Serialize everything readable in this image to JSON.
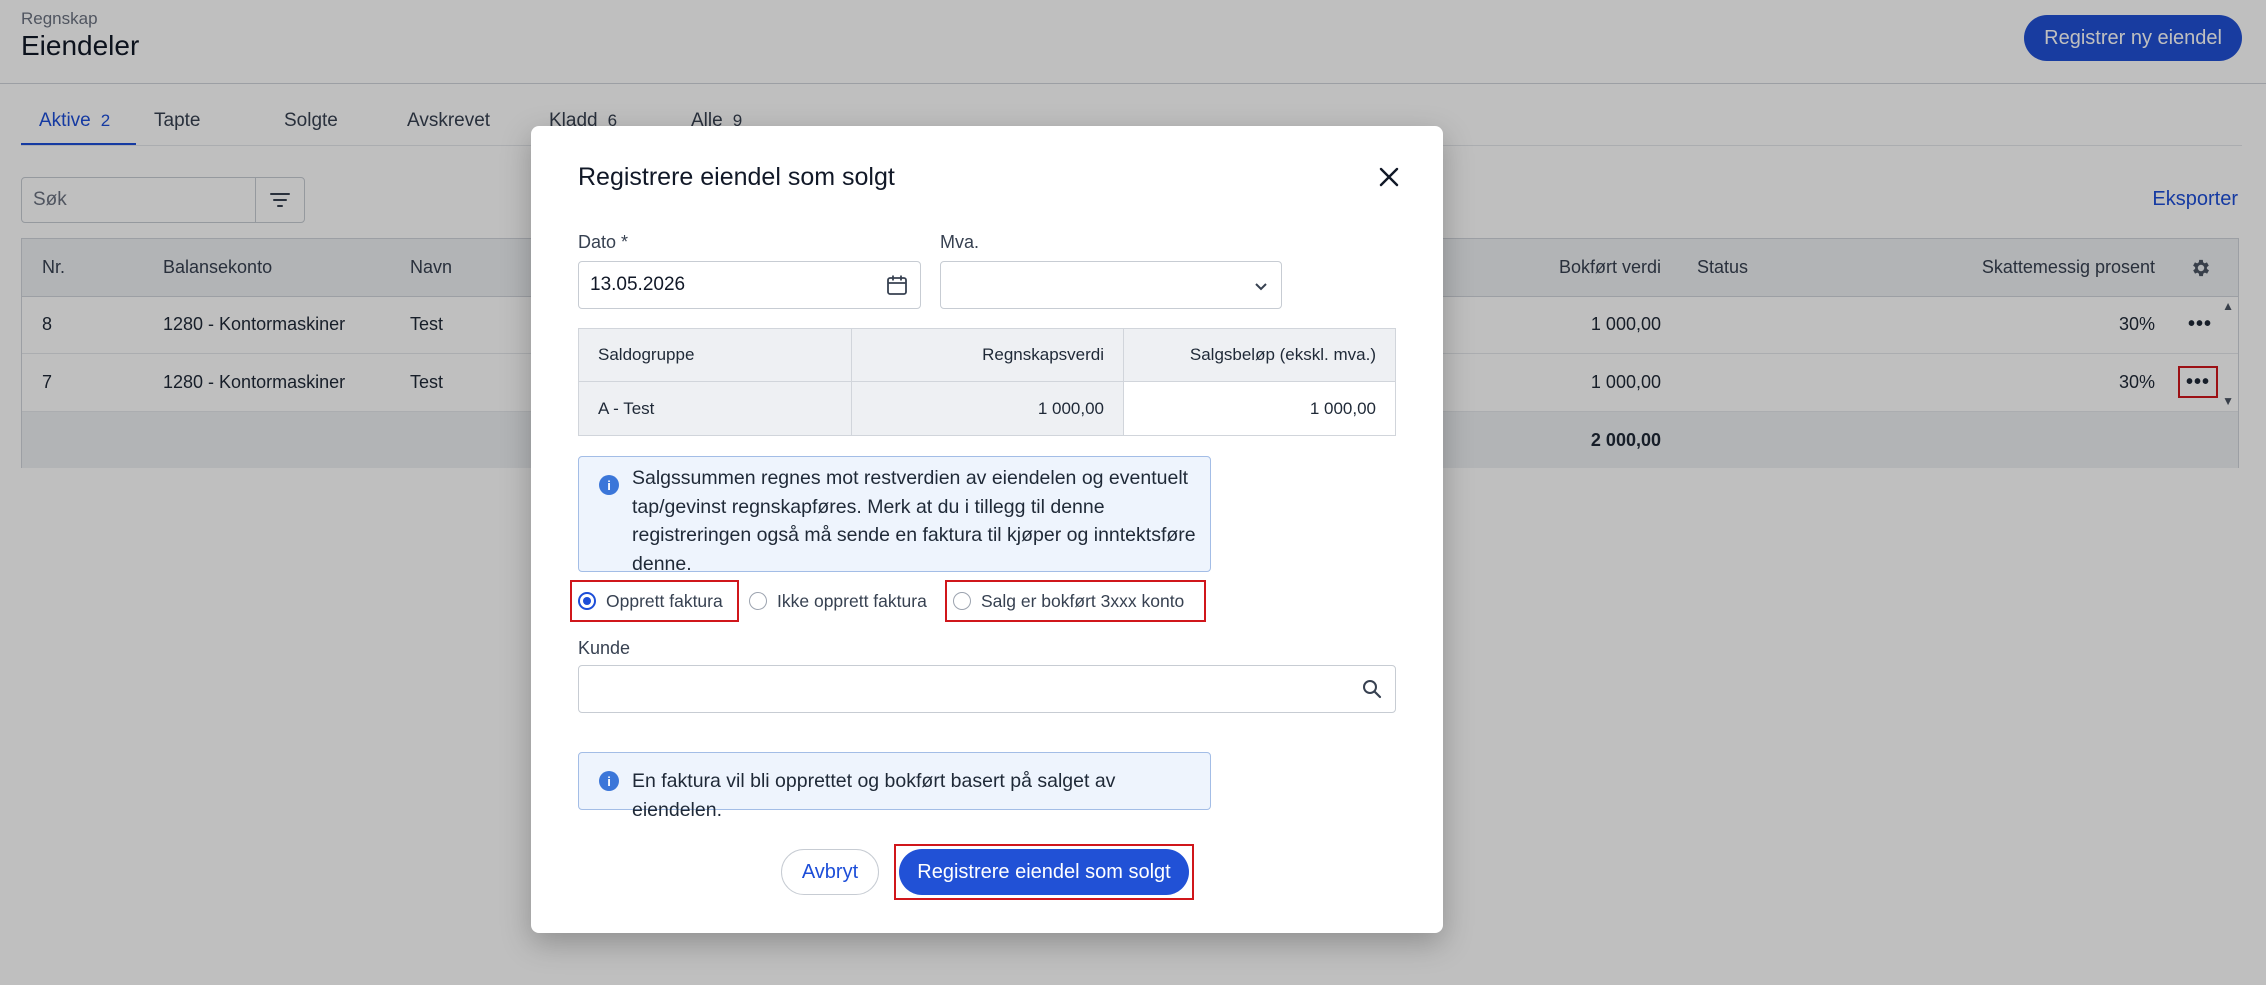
{
  "header": {
    "breadcrumb": "Regnskap",
    "title": "Eiendeler",
    "register_button": "Registrer ny eiendel"
  },
  "tabs": [
    {
      "label": "Aktive",
      "count": "2"
    },
    {
      "label": "Tapte",
      "count": ""
    },
    {
      "label": "Solgte",
      "count": ""
    },
    {
      "label": "Avskrevet",
      "count": ""
    },
    {
      "label": "Kladd",
      "count": "6"
    },
    {
      "label": "Alle",
      "count": "9"
    }
  ],
  "toolbar": {
    "search_placeholder": "Søk",
    "export_label": "Eksporter"
  },
  "table": {
    "columns": {
      "nr": "Nr.",
      "balance_account": "Balansekonto",
      "name": "Navn",
      "book_value": "Bokført verdi",
      "status": "Status",
      "tax_percent": "Skattemessig prosent"
    },
    "rows": [
      {
        "nr": "8",
        "balance_account": "1280 - Kontormaskiner",
        "name": "Test",
        "book_value": "1 000,00",
        "status": "",
        "tax_percent": "30%"
      },
      {
        "nr": "7",
        "balance_account": "1280 - Kontormaskiner",
        "name": "Test",
        "book_value": "1 000,00",
        "status": "",
        "tax_percent": "30%"
      }
    ],
    "total_book_value": "2 000,00"
  },
  "modal": {
    "title": "Registrere eiendel som solgt",
    "date_label": "Dato *",
    "date_value": "13.05.2026",
    "vat_label": "Mva.",
    "vat_value": "",
    "grid": {
      "headers": [
        "Saldogruppe",
        "Regnskapsverdi",
        "Salgsbeløp (ekskl. mva.)"
      ],
      "row": [
        "A - Test",
        "1 000,00",
        "1 000,00"
      ]
    },
    "info_1": "Salgssummen regnes mot restverdien av eiendelen og eventuelt tap/gevinst regnskapføres. Merk at du i tillegg til denne registreringen også må sende en faktura til kjøper og inntektsføre denne.",
    "radio_options": [
      "Opprett faktura",
      "Ikke opprett faktura",
      "Salg er bokført 3xxx konto"
    ],
    "radio_selected": "Opprett faktura",
    "customer_label": "Kunde",
    "customer_value": "",
    "info_2": "En faktura vil bli opprettet og bokført basert på salget av eiendelen.",
    "cancel_button": "Avbryt",
    "submit_button": "Registrere eiendel som solgt"
  },
  "colors": {
    "primary": "#2151d6",
    "link": "#1d4ed8",
    "highlight_outline": "#d0161b",
    "info_bg": "#eef4fd"
  }
}
